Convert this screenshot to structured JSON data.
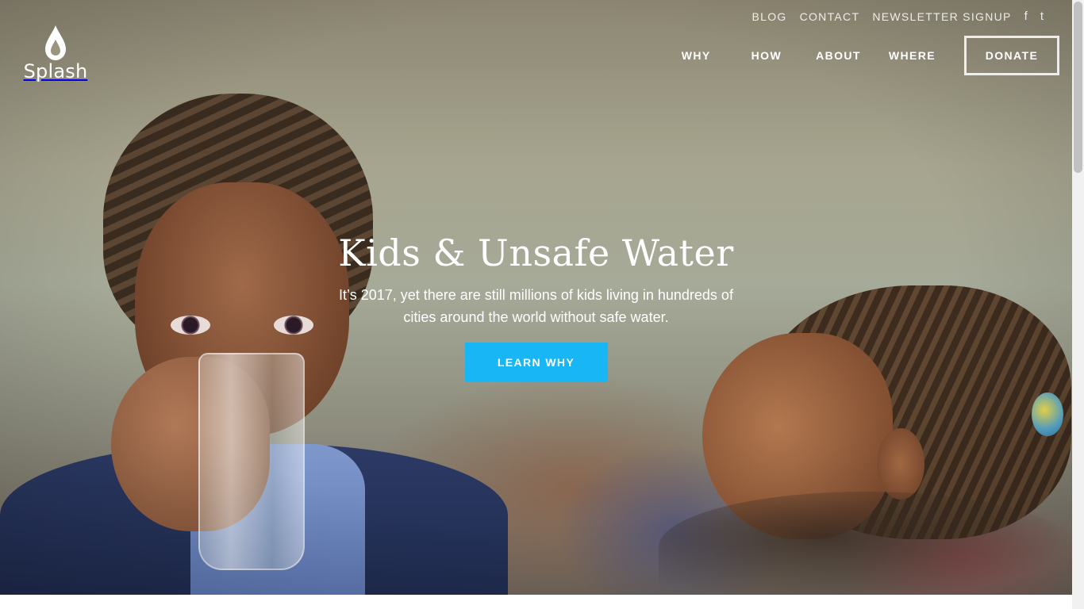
{
  "brand": {
    "name": "Splash",
    "icon": "water-drop-icon"
  },
  "top_nav": {
    "items": [
      "BLOG",
      "CONTACT",
      "NEWSLETTER SIGNUP"
    ],
    "facebook": "f",
    "twitter": "t"
  },
  "main_nav": {
    "items": [
      "WHY",
      "HOW",
      "ABOUT",
      "WHERE"
    ],
    "donate": "DONATE"
  },
  "hero": {
    "title": "Kids & Unsafe Water",
    "subtitle": "It’s 2017, yet there are still millions of kids living in hundreds of cities around the world without safe water.",
    "cta": "LEARN WHY"
  },
  "colors": {
    "accent": "#18b6f5",
    "text": "#ffffff"
  }
}
